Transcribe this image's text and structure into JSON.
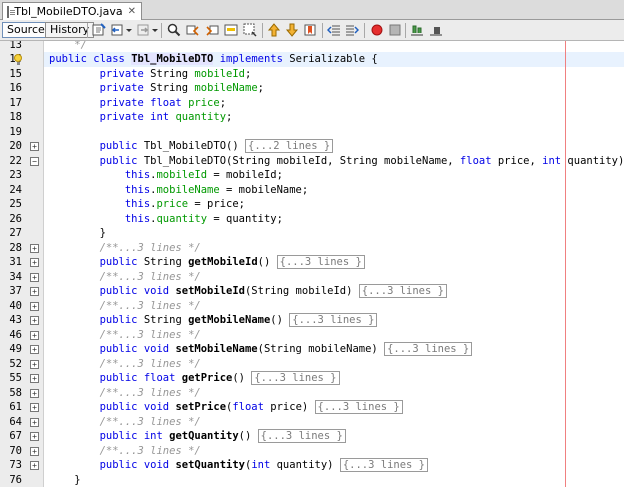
{
  "tab": {
    "title": "Tbl_MobileDTO.java",
    "close": "✕"
  },
  "toolbar": {
    "source_label": "Source",
    "history_label": "History"
  },
  "editor": {
    "lines": [
      {
        "n": "13",
        "fold": "none",
        "segs": [
          [
            "cm",
            "    */"
          ]
        ]
      },
      {
        "n": "14",
        "fold": "none",
        "segs": [
          [
            "kw",
            "public "
          ],
          [
            "kw",
            "class "
          ],
          [
            "cls",
            "Tbl_MobileDTO"
          ],
          [
            "kw",
            " implements "
          ],
          [
            "t",
            "Serializable {"
          ]
        ]
      },
      {
        "n": "15",
        "fold": "none",
        "segs": [
          [
            "t",
            "        "
          ],
          [
            "kw",
            "private "
          ],
          [
            "t",
            "String "
          ],
          [
            "fld",
            "mobileId"
          ],
          [
            "t",
            ";"
          ]
        ]
      },
      {
        "n": "16",
        "fold": "none",
        "segs": [
          [
            "t",
            "        "
          ],
          [
            "kw",
            "private "
          ],
          [
            "t",
            "String "
          ],
          [
            "fld",
            "mobileName"
          ],
          [
            "t",
            ";"
          ]
        ]
      },
      {
        "n": "17",
        "fold": "none",
        "segs": [
          [
            "t",
            "        "
          ],
          [
            "kw",
            "private float "
          ],
          [
            "fld",
            "price"
          ],
          [
            "t",
            ";"
          ]
        ]
      },
      {
        "n": "18",
        "fold": "none",
        "segs": [
          [
            "t",
            "        "
          ],
          [
            "kw",
            "private int "
          ],
          [
            "fld",
            "quantity"
          ],
          [
            "t",
            ";"
          ]
        ]
      },
      {
        "n": "19",
        "fold": "none",
        "segs": []
      },
      {
        "n": "20",
        "fold": "plus",
        "segs": [
          [
            "t",
            "        "
          ],
          [
            "kw",
            "public "
          ],
          [
            "t",
            "Tbl_MobileDTO() "
          ],
          [
            "fb",
            "{...2 lines }"
          ]
        ]
      },
      {
        "n": "22",
        "fold": "minus",
        "segs": [
          [
            "t",
            "        "
          ],
          [
            "kw",
            "public "
          ],
          [
            "t",
            "Tbl_MobileDTO(String mobileId, String mobileName, "
          ],
          [
            "kw",
            "float "
          ],
          [
            "t",
            "price, "
          ],
          [
            "kw",
            "int "
          ],
          [
            "t",
            "quantity) {"
          ]
        ]
      },
      {
        "n": "23",
        "fold": "none",
        "segs": [
          [
            "t",
            "            "
          ],
          [
            "kw",
            "this"
          ],
          [
            "t",
            "."
          ],
          [
            "fld",
            "mobileId"
          ],
          [
            "t",
            " = mobileId;"
          ]
        ]
      },
      {
        "n": "24",
        "fold": "none",
        "segs": [
          [
            "t",
            "            "
          ],
          [
            "kw",
            "this"
          ],
          [
            "t",
            "."
          ],
          [
            "fld",
            "mobileName"
          ],
          [
            "t",
            " = mobileName;"
          ]
        ]
      },
      {
        "n": "25",
        "fold": "none",
        "segs": [
          [
            "t",
            "            "
          ],
          [
            "kw",
            "this"
          ],
          [
            "t",
            "."
          ],
          [
            "fld",
            "price"
          ],
          [
            "t",
            " = price;"
          ]
        ]
      },
      {
        "n": "26",
        "fold": "none",
        "segs": [
          [
            "t",
            "            "
          ],
          [
            "kw",
            "this"
          ],
          [
            "t",
            "."
          ],
          [
            "fld",
            "quantity"
          ],
          [
            "t",
            " = quantity;"
          ]
        ]
      },
      {
        "n": "27",
        "fold": "none",
        "segs": [
          [
            "t",
            "        }"
          ]
        ]
      },
      {
        "n": "28",
        "fold": "plus",
        "segs": [
          [
            "t",
            "        "
          ],
          [
            "cm",
            "/**...3 lines */"
          ]
        ]
      },
      {
        "n": "31",
        "fold": "plus",
        "segs": [
          [
            "t",
            "        "
          ],
          [
            "kw",
            "public "
          ],
          [
            "t",
            "String "
          ],
          [
            "b",
            "getMobileId"
          ],
          [
            "t",
            "() "
          ],
          [
            "fb",
            "{...3 lines }"
          ]
        ]
      },
      {
        "n": "34",
        "fold": "plus",
        "segs": [
          [
            "t",
            "        "
          ],
          [
            "cm",
            "/**...3 lines */"
          ]
        ]
      },
      {
        "n": "37",
        "fold": "plus",
        "segs": [
          [
            "t",
            "        "
          ],
          [
            "kw",
            "public void "
          ],
          [
            "b",
            "setMobileId"
          ],
          [
            "t",
            "(String mobileId) "
          ],
          [
            "fb",
            "{...3 lines }"
          ]
        ]
      },
      {
        "n": "40",
        "fold": "plus",
        "segs": [
          [
            "t",
            "        "
          ],
          [
            "cm",
            "/**...3 lines */"
          ]
        ]
      },
      {
        "n": "43",
        "fold": "plus",
        "segs": [
          [
            "t",
            "        "
          ],
          [
            "kw",
            "public "
          ],
          [
            "t",
            "String "
          ],
          [
            "b",
            "getMobileName"
          ],
          [
            "t",
            "() "
          ],
          [
            "fb",
            "{...3 lines }"
          ]
        ]
      },
      {
        "n": "46",
        "fold": "plus",
        "segs": [
          [
            "t",
            "        "
          ],
          [
            "cm",
            "/**...3 lines */"
          ]
        ]
      },
      {
        "n": "49",
        "fold": "plus",
        "segs": [
          [
            "t",
            "        "
          ],
          [
            "kw",
            "public void "
          ],
          [
            "b",
            "setMobileName"
          ],
          [
            "t",
            "(String mobileName) "
          ],
          [
            "fb",
            "{...3 lines }"
          ]
        ]
      },
      {
        "n": "52",
        "fold": "plus",
        "segs": [
          [
            "t",
            "        "
          ],
          [
            "cm",
            "/**...3 lines */"
          ]
        ]
      },
      {
        "n": "55",
        "fold": "plus",
        "segs": [
          [
            "t",
            "        "
          ],
          [
            "kw",
            "public float "
          ],
          [
            "b",
            "getPrice"
          ],
          [
            "t",
            "() "
          ],
          [
            "fb",
            "{...3 lines }"
          ]
        ]
      },
      {
        "n": "58",
        "fold": "plus",
        "segs": [
          [
            "t",
            "        "
          ],
          [
            "cm",
            "/**...3 lines */"
          ]
        ]
      },
      {
        "n": "61",
        "fold": "plus",
        "segs": [
          [
            "t",
            "        "
          ],
          [
            "kw",
            "public void "
          ],
          [
            "b",
            "setPrice"
          ],
          [
            "t",
            "("
          ],
          [
            "kw",
            "float "
          ],
          [
            "t",
            "price) "
          ],
          [
            "fb",
            "{...3 lines }"
          ]
        ]
      },
      {
        "n": "64",
        "fold": "plus",
        "segs": [
          [
            "t",
            "        "
          ],
          [
            "cm",
            "/**...3 lines */"
          ]
        ]
      },
      {
        "n": "67",
        "fold": "plus",
        "segs": [
          [
            "t",
            "        "
          ],
          [
            "kw",
            "public int "
          ],
          [
            "b",
            "getQuantity"
          ],
          [
            "t",
            "() "
          ],
          [
            "fb",
            "{...3 lines }"
          ]
        ]
      },
      {
        "n": "70",
        "fold": "plus",
        "segs": [
          [
            "t",
            "        "
          ],
          [
            "cm",
            "/**...3 lines */"
          ]
        ]
      },
      {
        "n": "73",
        "fold": "plus",
        "segs": [
          [
            "t",
            "        "
          ],
          [
            "kw",
            "public void "
          ],
          [
            "b",
            "setQuantity"
          ],
          [
            "t",
            "("
          ],
          [
            "kw",
            "int "
          ],
          [
            "t",
            "quantity) "
          ],
          [
            "fb",
            "{...3 lines }"
          ]
        ]
      },
      {
        "n": "76",
        "fold": "none",
        "segs": [
          [
            "t",
            "    }"
          ]
        ]
      }
    ]
  }
}
